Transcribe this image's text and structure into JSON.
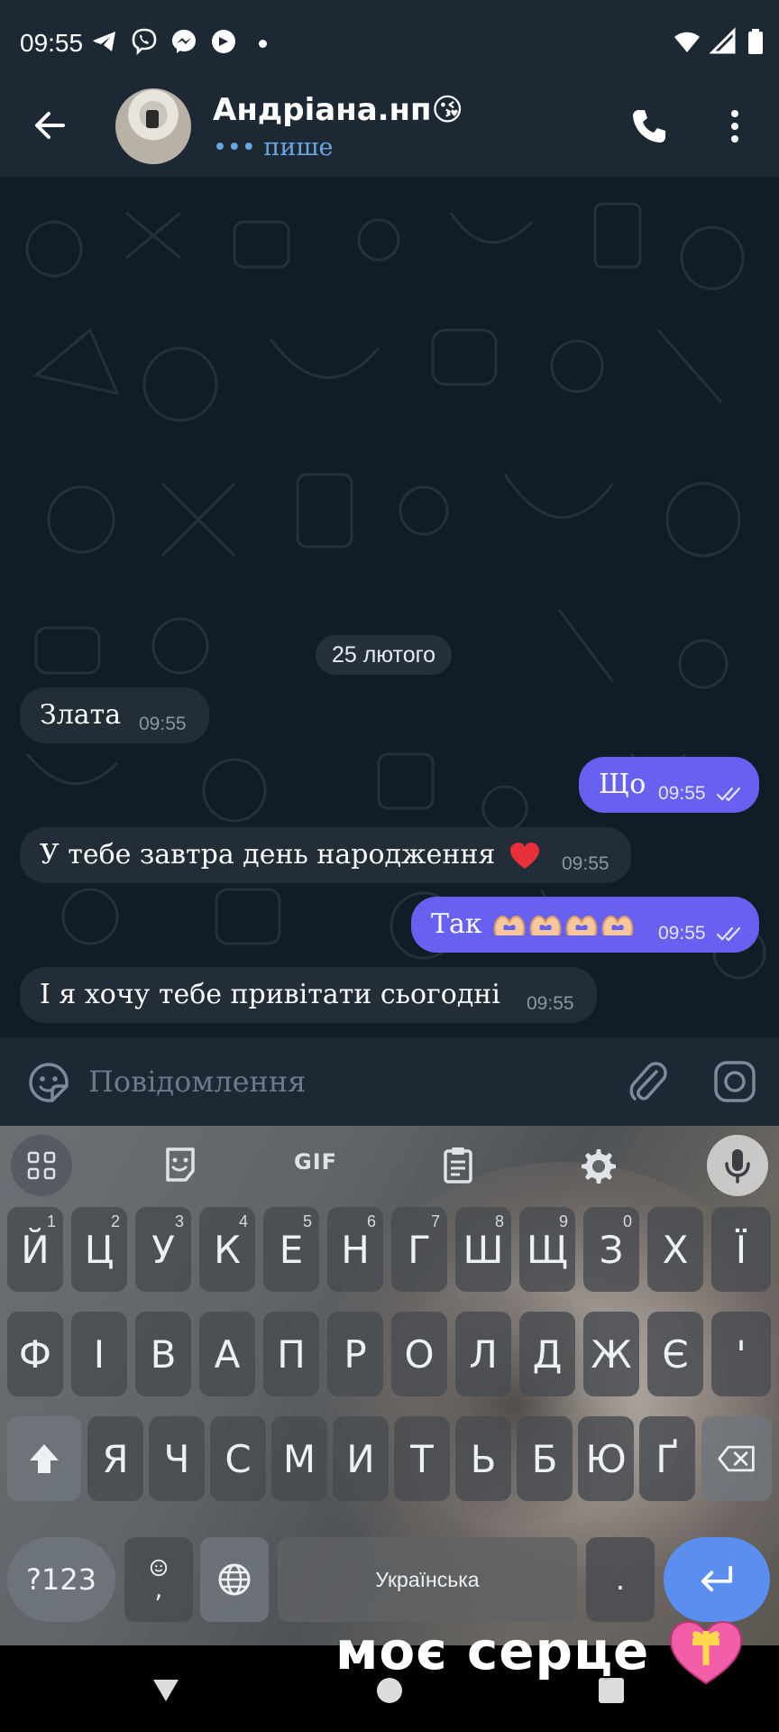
{
  "status_bar": {
    "time": "09:55",
    "notification_icons": [
      "telegram-icon",
      "viber-icon",
      "messenger-icon",
      "helo-icon"
    ],
    "system_icons": [
      "wifi-icon",
      "signal-icon",
      "battery-icon"
    ]
  },
  "header": {
    "contact_name": "Андріана.нп😘",
    "status": "••• пише",
    "icons": [
      "back-arrow-icon",
      "phone-icon",
      "more-vert-icon"
    ]
  },
  "chat": {
    "date_chip": "25 лютого",
    "messages": [
      {
        "direction": "in",
        "text": "Злата",
        "time": "09:55"
      },
      {
        "direction": "out",
        "text": "Що",
        "time": "09:55",
        "read": true
      },
      {
        "direction": "in",
        "text": "У тебе завтра день народження",
        "emoji": "red-heart",
        "time": "09:55"
      },
      {
        "direction": "out",
        "text": "Так",
        "emoji": "heart-hands-x4",
        "time": "09:55",
        "read": true
      },
      {
        "direction": "in",
        "text": "І я хочу тебе привітати сьогодні",
        "time": "09:55"
      }
    ]
  },
  "composer": {
    "placeholder": "Повідомлення",
    "icons": [
      "sticker-emoji-icon",
      "attach-paperclip-icon",
      "camera-icon"
    ]
  },
  "keyboard": {
    "toolbar": {
      "gif_label": "GIF",
      "icons": [
        "apps-grid-icon",
        "sticker-icon",
        "gif-icon",
        "clipboard-icon",
        "settings-gear-icon",
        "microphone-icon"
      ]
    },
    "row1": [
      {
        "label": "Й",
        "hint": "1"
      },
      {
        "label": "Ц",
        "hint": "2"
      },
      {
        "label": "У",
        "hint": "3"
      },
      {
        "label": "К",
        "hint": "4"
      },
      {
        "label": "Е",
        "hint": "5"
      },
      {
        "label": "Н",
        "hint": "6"
      },
      {
        "label": "Г",
        "hint": "7"
      },
      {
        "label": "Ш",
        "hint": "8"
      },
      {
        "label": "Щ",
        "hint": "9"
      },
      {
        "label": "З",
        "hint": "0"
      },
      {
        "label": "Х",
        "hint": ""
      },
      {
        "label": "Ї",
        "hint": ""
      }
    ],
    "row2": [
      "Ф",
      "І",
      "В",
      "А",
      "П",
      "Р",
      "О",
      "Л",
      "Д",
      "Ж",
      "Є",
      "'"
    ],
    "row3": [
      "Я",
      "Ч",
      "С",
      "М",
      "И",
      "Т",
      "Ь",
      "Б",
      "Ю",
      "Ґ"
    ],
    "bottom": {
      "symbols": "?123",
      "comma": ",",
      "space": "Українська",
      "period": "."
    }
  },
  "overlay": {
    "caption": "моє серце"
  },
  "colors": {
    "header_bg": "#1c2834",
    "chat_bg": "#121c26",
    "incoming_bubble": "#222d38",
    "outgoing_bubble": "#6760f0",
    "typing_status": "#6aa7e0",
    "enter_key": "#5a8ff0"
  }
}
